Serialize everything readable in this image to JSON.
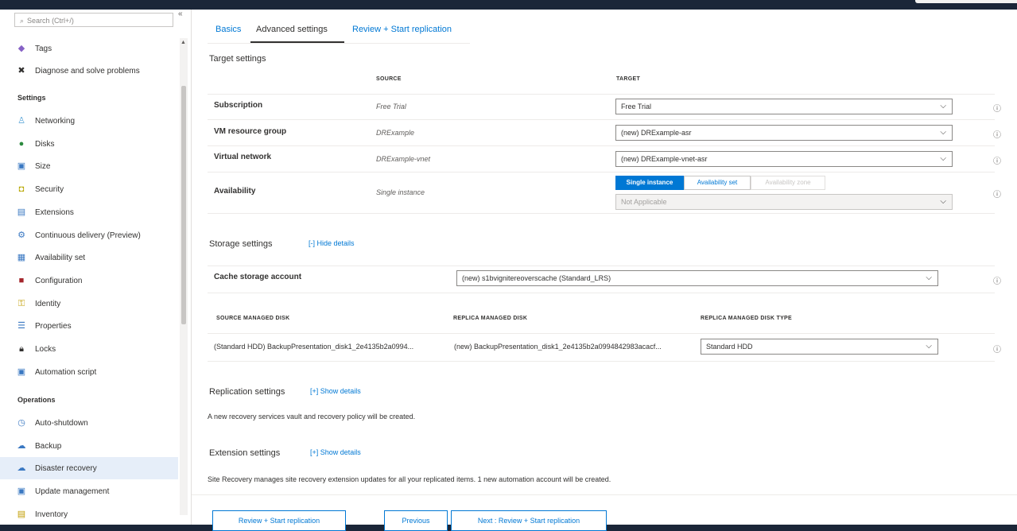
{
  "sidebar": {
    "search_placeholder": "Search (Ctrl+/)",
    "collapse_glyph": "«",
    "items_top": [
      {
        "label": "Tags",
        "icon": "tag-icon",
        "glyph": "◆",
        "color": "#8661c5"
      },
      {
        "label": "Diagnose and solve problems",
        "icon": "wrench-icon",
        "glyph": "✖",
        "color": "#323130"
      }
    ],
    "section_settings": "Settings",
    "settings_items": [
      {
        "label": "Networking",
        "icon": "networking-icon",
        "glyph": "♙",
        "color": "#50a0d6"
      },
      {
        "label": "Disks",
        "icon": "disks-icon",
        "glyph": "●",
        "color": "#2b8a3e"
      },
      {
        "label": "Size",
        "icon": "size-icon",
        "glyph": "▣",
        "color": "#3a78c2"
      },
      {
        "label": "Security",
        "icon": "shield-icon",
        "glyph": "◘",
        "color": "#b8a700"
      },
      {
        "label": "Extensions",
        "icon": "extensions-icon",
        "glyph": "▤",
        "color": "#3a78c2"
      },
      {
        "label": "Continuous delivery (Preview)",
        "icon": "continuous-delivery-icon",
        "glyph": "⚙",
        "color": "#3a78c2"
      },
      {
        "label": "Availability set",
        "icon": "availability-set-icon",
        "glyph": "▦",
        "color": "#3a78c2"
      },
      {
        "label": "Configuration",
        "icon": "configuration-icon",
        "glyph": "■",
        "color": "#a4262c"
      },
      {
        "label": "Identity",
        "icon": "identity-icon",
        "glyph": "⚿",
        "color": "#c19c00"
      },
      {
        "label": "Properties",
        "icon": "properties-icon",
        "glyph": "☰",
        "color": "#3a78c2"
      },
      {
        "label": "Locks",
        "icon": "lock-icon",
        "glyph": "🔒︎",
        "color": "#323130"
      },
      {
        "label": "Automation script",
        "icon": "automation-script-icon",
        "glyph": "▣",
        "color": "#3a78c2"
      }
    ],
    "section_operations": "Operations",
    "operations_items": [
      {
        "label": "Auto-shutdown",
        "icon": "clock-icon",
        "glyph": "◷",
        "color": "#3a78c2"
      },
      {
        "label": "Backup",
        "icon": "backup-icon",
        "glyph": "☁",
        "color": "#3a78c2"
      },
      {
        "label": "Disaster recovery",
        "icon": "disaster-recovery-icon",
        "glyph": "☁",
        "color": "#3a78c2",
        "active": true
      },
      {
        "label": "Update management",
        "icon": "update-management-icon",
        "glyph": "▣",
        "color": "#3a78c2"
      },
      {
        "label": "Inventory",
        "icon": "inventory-icon",
        "glyph": "▤",
        "color": "#c19c00"
      }
    ]
  },
  "tabs": [
    {
      "label": "Basics",
      "active": false
    },
    {
      "label": "Advanced settings",
      "active": true
    },
    {
      "label": "Review + Start replication",
      "active": false
    }
  ],
  "target_settings": {
    "title": "Target settings",
    "col_source": "SOURCE",
    "col_target": "TARGET",
    "rows": [
      {
        "label": "Subscription",
        "source": "Free Trial",
        "target": "Free Trial"
      },
      {
        "label": "VM resource group",
        "source": "DRExample",
        "target": "(new) DRExample-asr"
      },
      {
        "label": "Virtual network",
        "source": "DRExample-vnet",
        "target": "(new) DRExample-vnet-asr"
      }
    ],
    "availability": {
      "label": "Availability",
      "source": "Single instance",
      "options": [
        "Single instance",
        "Availability set",
        "Availability zone"
      ],
      "selected": "Single instance",
      "dropdown_value": "Not Applicable"
    }
  },
  "storage_settings": {
    "title": "Storage settings",
    "toggle": "[-] Hide details",
    "cache_label": "Cache storage account",
    "cache_value": "(new) s1bvignitereoverscache (Standard_LRS)",
    "col_source_disk": "SOURCE MANAGED DISK",
    "col_replica_disk": "REPLICA MANAGED DISK",
    "col_replica_type": "REPLICA MANAGED DISK TYPE",
    "disk_row": {
      "source": "(Standard HDD) BackupPresentation_disk1_2e4135b2a0994...",
      "replica": "(new) BackupPresentation_disk1_2e4135b2a0994842983acacf...",
      "type": "Standard HDD"
    }
  },
  "replication_settings": {
    "title": "Replication settings",
    "toggle": "[+] Show details",
    "description": "A new recovery services vault and recovery policy will be created."
  },
  "extension_settings": {
    "title": "Extension settings",
    "toggle": "[+] Show details",
    "description": "Site Recovery manages site recovery extension updates for all your replicated items. 1 new automation account will be created."
  },
  "footer": {
    "review_button": "Review + Start replication",
    "previous_button": "Previous",
    "next_button": "Next : Review + Start replication"
  },
  "glyphs": {
    "chevron": "⌵",
    "info": "ⓘ",
    "search": "⌕",
    "scroll_up": "▲"
  }
}
